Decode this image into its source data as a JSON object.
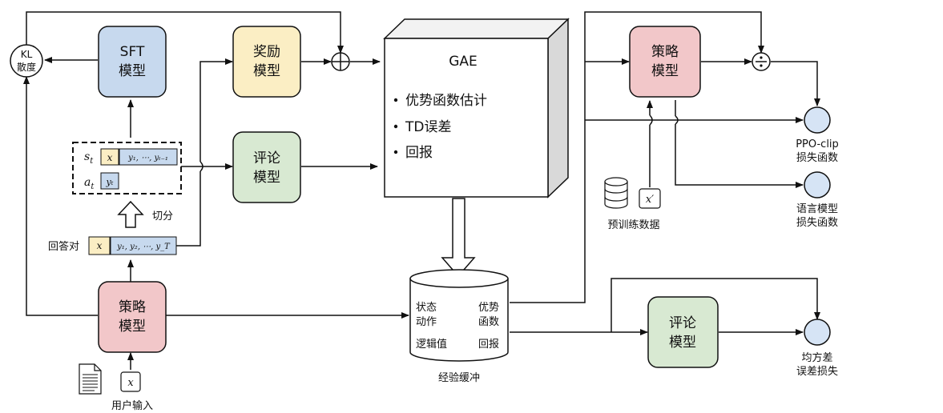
{
  "kl": {
    "line1": "KL",
    "line2": "散度"
  },
  "sft": {
    "line1": "SFT",
    "line2": "模型"
  },
  "reward": {
    "line1": "奖励",
    "line2": "模型"
  },
  "critic_top": {
    "line1": "评论",
    "line2": "模型"
  },
  "policy_left": {
    "line1": "策略",
    "line2": "模型"
  },
  "gae": {
    "title": "GAE",
    "bullets": [
      "优势函数估计",
      "TD误差",
      "回报"
    ]
  },
  "policy_right": {
    "line1": "策略",
    "line2": "模型"
  },
  "critic_bottom": {
    "line1": "评论",
    "line2": "模型"
  },
  "split_label": "切分",
  "answer_pair_label": "回答对",
  "user_input_label": "用户输入",
  "pretrain_label": "预训练数据",
  "buffer": {
    "name": "经验缓冲",
    "state_action": [
      "状态",
      "动作"
    ],
    "advantage": [
      "优势",
      "函数"
    ],
    "logit": "逻辑值",
    "return": "回报"
  },
  "losses": {
    "ppo_clip": [
      "PPO-clip",
      "损失函数"
    ],
    "lm": [
      "语言模型",
      "损失函数"
    ],
    "mse": [
      "均方差",
      "误差损失"
    ]
  },
  "tokens": {
    "s_t": "s",
    "a_t": "a",
    "x": "x",
    "y_prev": "y₁, ⋯, yₜ₋₁",
    "y_t": "yₜ",
    "y_full": "y₁, y₂, ⋯, y_T",
    "x_prime": "x′"
  }
}
